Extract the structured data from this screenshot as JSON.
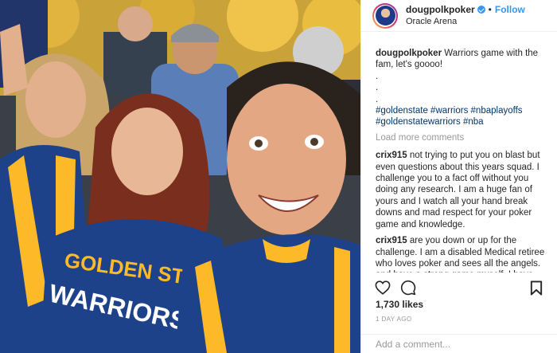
{
  "header": {
    "username": "dougpolkpoker",
    "follow_label": "Follow",
    "separator": "•",
    "location": "Oracle Arena"
  },
  "caption": {
    "username": "dougpolkpoker",
    "text": "Warriors game with the fam, let's goooo!",
    "dots": [
      ".",
      ".",
      "."
    ],
    "hashtags": "#goldenstate #warriors #nbaplayoffs #goldenstatewarriors #nba"
  },
  "load_more_label": "Load more comments",
  "comments": [
    {
      "user": "crix915",
      "text": "not trying to put you on blast but even questions about this years squad. I challenge you to a fact off without you doing any research. I am a huge fan of yours and I watch all your hand break downs and mad respect for your poker game and knowledge."
    },
    {
      "user": "crix915",
      "text": "are you down or up for the challenge. I am a disabled Medical retiree who loves poker and sees all the angels. and have a strong game myself. I have"
    }
  ],
  "actions": {
    "icons": [
      "heart-icon",
      "comment-icon",
      "bookmark-icon"
    ]
  },
  "likes_label": "1,730 likes",
  "timestamp": "1 DAY AGO",
  "add_comment_placeholder": "Add a comment...",
  "photo": {
    "jersey_text_line1": "GOLDEN STATE",
    "jersey_text_line2": "WARRIORS",
    "colors": {
      "warriors_blue": "#1d428a",
      "warriors_gold": "#fdb927",
      "link": "#003569",
      "follow": "#3897f0"
    }
  }
}
